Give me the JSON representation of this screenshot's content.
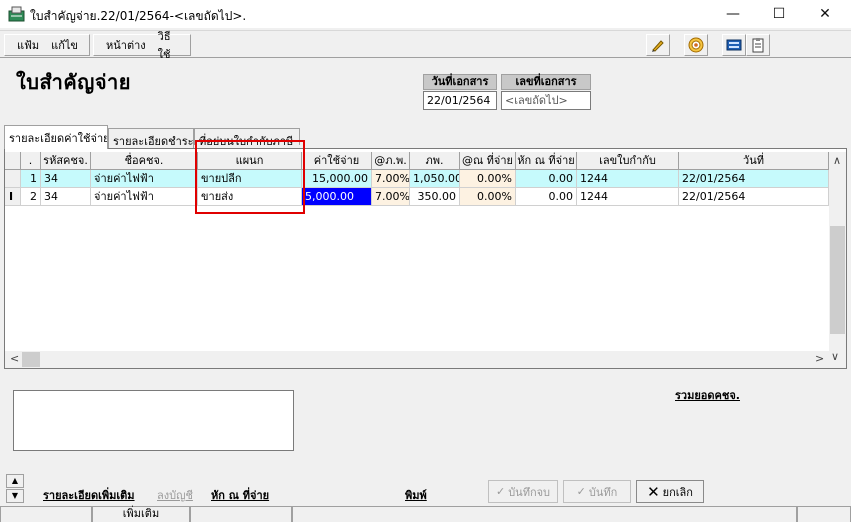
{
  "window": {
    "title": "ใบสำคัญจ่าย.22/01/2564-<เลขถัดไป>."
  },
  "menu": {
    "items": [
      "แฟ้ม",
      "แก้ไข",
      "หน้าต่าง",
      "วิธีใช้"
    ]
  },
  "toolbar": {
    "icons": [
      "pen-icon",
      "target-icon",
      "calculator-icon",
      "clipboard-icon"
    ]
  },
  "header": {
    "title": "ใบสำคัญจ่าย",
    "doc_date_label": "วันที่เอกสาร",
    "doc_date_value": "22/01/2564",
    "doc_no_label": "เลขที่เอกสาร",
    "doc_no_value": "<เลขถัดไป>"
  },
  "tabs": [
    "รายละเอียดค่าใช้จ่าย",
    "รายละเอียดชำระ",
    "ที่อยู่บนใบกำกับภาษี"
  ],
  "grid": {
    "columns": [
      ".",
      "รหัสคชจ.",
      "ชื่อคชจ.",
      "แผนก",
      "ค่าใช้จ่าย",
      "@ภ.พ.",
      "ภพ.",
      "@ณ ที่จ่าย",
      "หัก ณ ที่จ่าย",
      "เลขใบกำกับ",
      "วันที่"
    ],
    "rows": [
      {
        "no": "1",
        "code": "34",
        "name": "จ่ายค่าไฟฟ้า",
        "dept": "ขายปลีก",
        "amount": "15,000.00",
        "vat_rate": "7.00%",
        "vat": "1,050.00",
        "wht_rate": "0.00%",
        "wht": "0.00",
        "invoice": "1244",
        "date": "22/01/2564"
      },
      {
        "no": "2",
        "code": "34",
        "name": "จ่ายค่าไฟฟ้า",
        "dept": "ขายส่ง",
        "amount": "5,000.00",
        "vat_rate": "7.00%",
        "vat": "350.00",
        "wht_rate": "0.00%",
        "wht": "0.00",
        "invoice": "1244",
        "date": "22/01/2564"
      }
    ]
  },
  "footer": {
    "sum_link": "รวมยอดคชจ.",
    "more_detail": "รายละเอียดเพิ่มเติม",
    "post_account": "ลงบัญชี",
    "wht_link": "หัก ณ ที่จ่าย",
    "print_link": "พิมพ์",
    "save_close": "บันทึกจบ",
    "save": "บันทึก",
    "cancel": "ยกเลิก",
    "status_add": "เพิ่มเติม"
  },
  "colors": {
    "selected_row": "#c6fafc",
    "selected_cell": "#0000ff",
    "highlight_box": "#e00000"
  }
}
